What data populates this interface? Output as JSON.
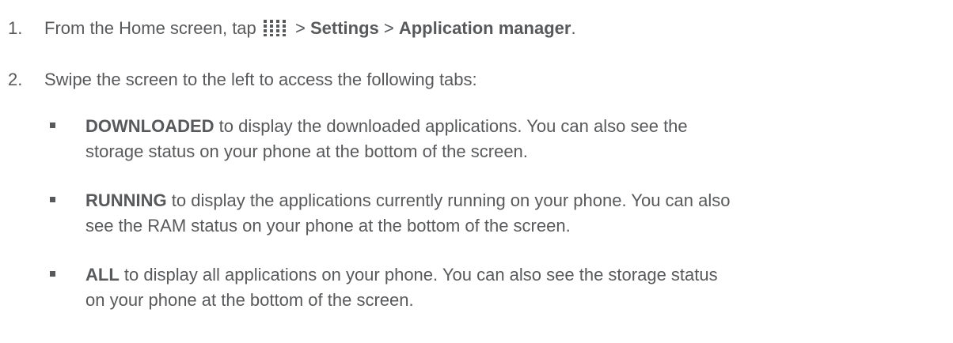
{
  "steps": [
    {
      "number": "1.",
      "prefix": "From the Home screen, tap ",
      "icon": "apps-grid-icon",
      "sep1": " > ",
      "settings": "Settings",
      "sep2": " > ",
      "app_manager": "Application manager",
      "suffix": "."
    },
    {
      "number": "2.",
      "text": "Swipe the screen to the left to access the following tabs:"
    }
  ],
  "bullets": [
    {
      "tab": "DOWNLOADED",
      "line1": " to display the downloaded applications. You can also see the",
      "line2": "storage status on your phone at the bottom of the screen."
    },
    {
      "tab": "RUNNING",
      "line1": " to display the applications currently running on your phone. You can also",
      "line2": "see the RAM status on your phone at the bottom of the screen."
    },
    {
      "tab": "ALL",
      "line1": " to display all applications on your phone. You can also see the storage status",
      "line2": "on your phone at the bottom of the screen."
    }
  ],
  "colors": {
    "text": "#58595b",
    "icon": "#58595b"
  }
}
